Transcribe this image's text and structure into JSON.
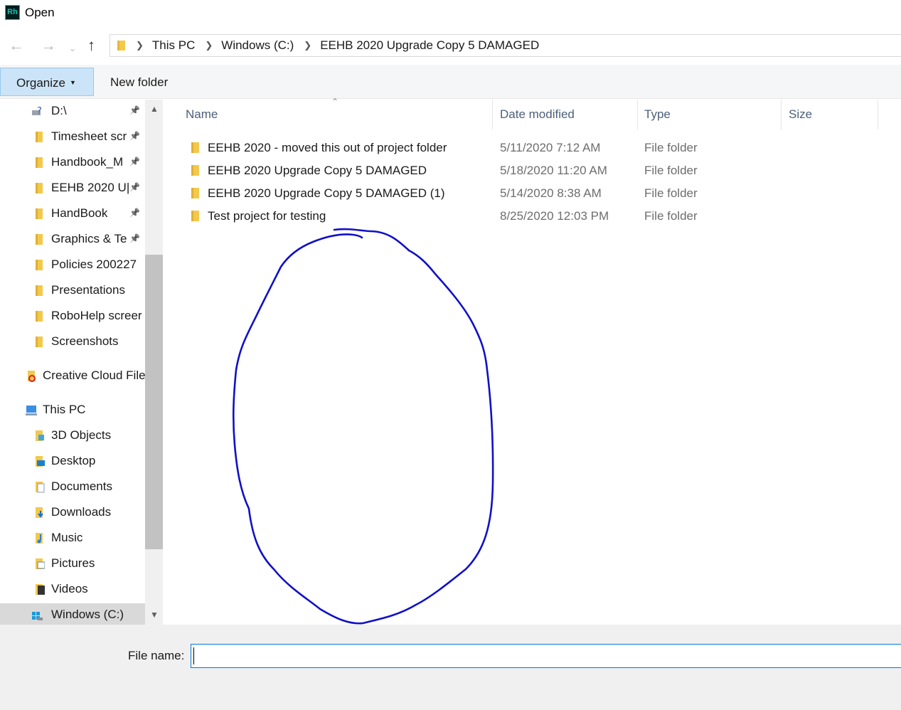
{
  "window": {
    "title": "Open",
    "app_icon_text": "Rh"
  },
  "address": {
    "crumbs": [
      "This PC",
      "Windows (C:)",
      "EEHB 2020 Upgrade Copy 5 DAMAGED"
    ]
  },
  "toolbar": {
    "organize_label": "Organize",
    "new_folder_label": "New folder"
  },
  "sidebar": {
    "items": [
      {
        "label": "D:\\",
        "icon": "drive-help-icon",
        "pinned": true
      },
      {
        "label": "Timesheet scr",
        "icon": "folder-icon",
        "pinned": true
      },
      {
        "label": "Handbook_M",
        "icon": "folder-icon",
        "pinned": true
      },
      {
        "label": "EEHB 2020 U|",
        "icon": "folder-icon",
        "pinned": true
      },
      {
        "label": "HandBook",
        "icon": "folder-icon",
        "pinned": true
      },
      {
        "label": "Graphics & Te",
        "icon": "folder-icon",
        "pinned": true
      },
      {
        "label": "Policies 200227",
        "icon": "folder-icon",
        "pinned": false
      },
      {
        "label": "Presentations",
        "icon": "folder-icon",
        "pinned": false
      },
      {
        "label": "RoboHelp screer",
        "icon": "folder-icon",
        "pinned": false
      },
      {
        "label": "Screenshots",
        "icon": "folder-icon",
        "pinned": false
      },
      {
        "label": "Creative Cloud File",
        "icon": "creative-cloud-icon",
        "pinned": false
      },
      {
        "label": "This PC",
        "icon": "computer-icon",
        "pinned": false
      },
      {
        "label": "3D Objects",
        "icon": "3d-objects-icon",
        "pinned": false
      },
      {
        "label": "Desktop",
        "icon": "desktop-icon",
        "pinned": false
      },
      {
        "label": "Documents",
        "icon": "documents-icon",
        "pinned": false
      },
      {
        "label": "Downloads",
        "icon": "downloads-icon",
        "pinned": false
      },
      {
        "label": "Music",
        "icon": "music-icon",
        "pinned": false
      },
      {
        "label": "Pictures",
        "icon": "pictures-icon",
        "pinned": false
      },
      {
        "label": "Videos",
        "icon": "videos-icon",
        "pinned": false
      },
      {
        "label": "Windows (C:)",
        "icon": "windows-drive-icon",
        "pinned": false,
        "selected": true
      }
    ]
  },
  "columns": {
    "name": "Name",
    "date_modified": "Date modified",
    "type": "Type",
    "size": "Size"
  },
  "files": [
    {
      "name": "EEHB 2020 - moved this out of project folder",
      "date": "5/11/2020 7:12 AM",
      "type": "File folder"
    },
    {
      "name": "EEHB 2020 Upgrade Copy 5 DAMAGED",
      "date": "5/18/2020 11:20 AM",
      "type": "File folder"
    },
    {
      "name": "EEHB 2020 Upgrade Copy 5 DAMAGED (1)",
      "date": "5/14/2020 8:38 AM",
      "type": "File folder"
    },
    {
      "name": "Test project for testing",
      "date": "8/25/2020 12:03 PM",
      "type": "File folder"
    }
  ],
  "filename": {
    "label": "File name:",
    "value": ""
  },
  "colors": {
    "annotation_ink": "#1010c8",
    "organize_bg": "#cce4f7",
    "folder_yellow": "#f2c94c",
    "header_text": "#4c607a"
  }
}
